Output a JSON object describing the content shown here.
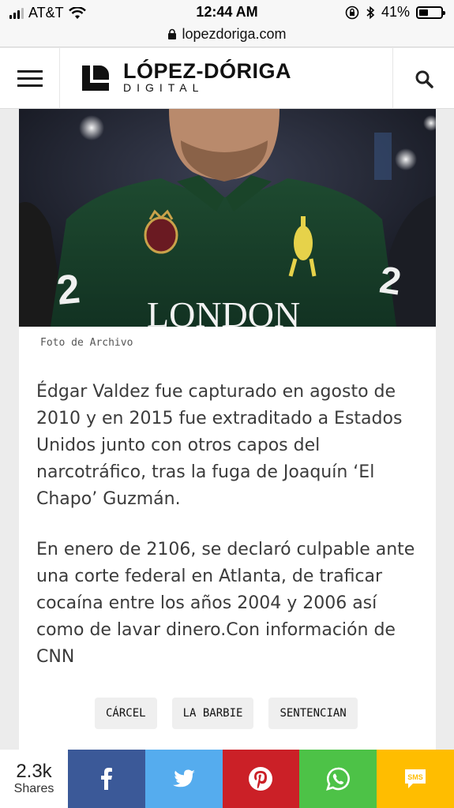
{
  "status_bar": {
    "carrier": "AT&T",
    "time": "12:44 AM",
    "battery": "41%",
    "battery_level": 0.41
  },
  "browser": {
    "url": "lopezdoriga.com"
  },
  "header": {
    "logo_title": "LÓPEZ-DÓRIGA",
    "logo_subtitle": "DIGITAL"
  },
  "article": {
    "caption": "Foto de Archivo",
    "paragraphs": [
      "Édgar Valdez fue capturado en agosto de 2010 y en 2015 fue extraditado a Estados Unidos junto con otros capos del narcotráfico, tras la fuga de Joaquín ‘El Chapo’ Guzmán.",
      "En enero de 2106, se declaró culpable ante una corte federal en Atlanta, de traficar cocaína entre los años 2004 y 2006 así como de lavar dinero.Con información de CNN"
    ],
    "tags": [
      "CÁRCEL",
      "LA BARBIE",
      "SENTENCIAN"
    ],
    "photo_shirt_text": "LONDON"
  },
  "share": {
    "count": "2.3k",
    "label": "Shares",
    "sms_label": "SMS",
    "colors": {
      "facebook": "#3b5998",
      "twitter": "#55acee",
      "pinterest": "#cb2027",
      "whatsapp": "#4dc247",
      "sms": "#ffbd00"
    }
  }
}
